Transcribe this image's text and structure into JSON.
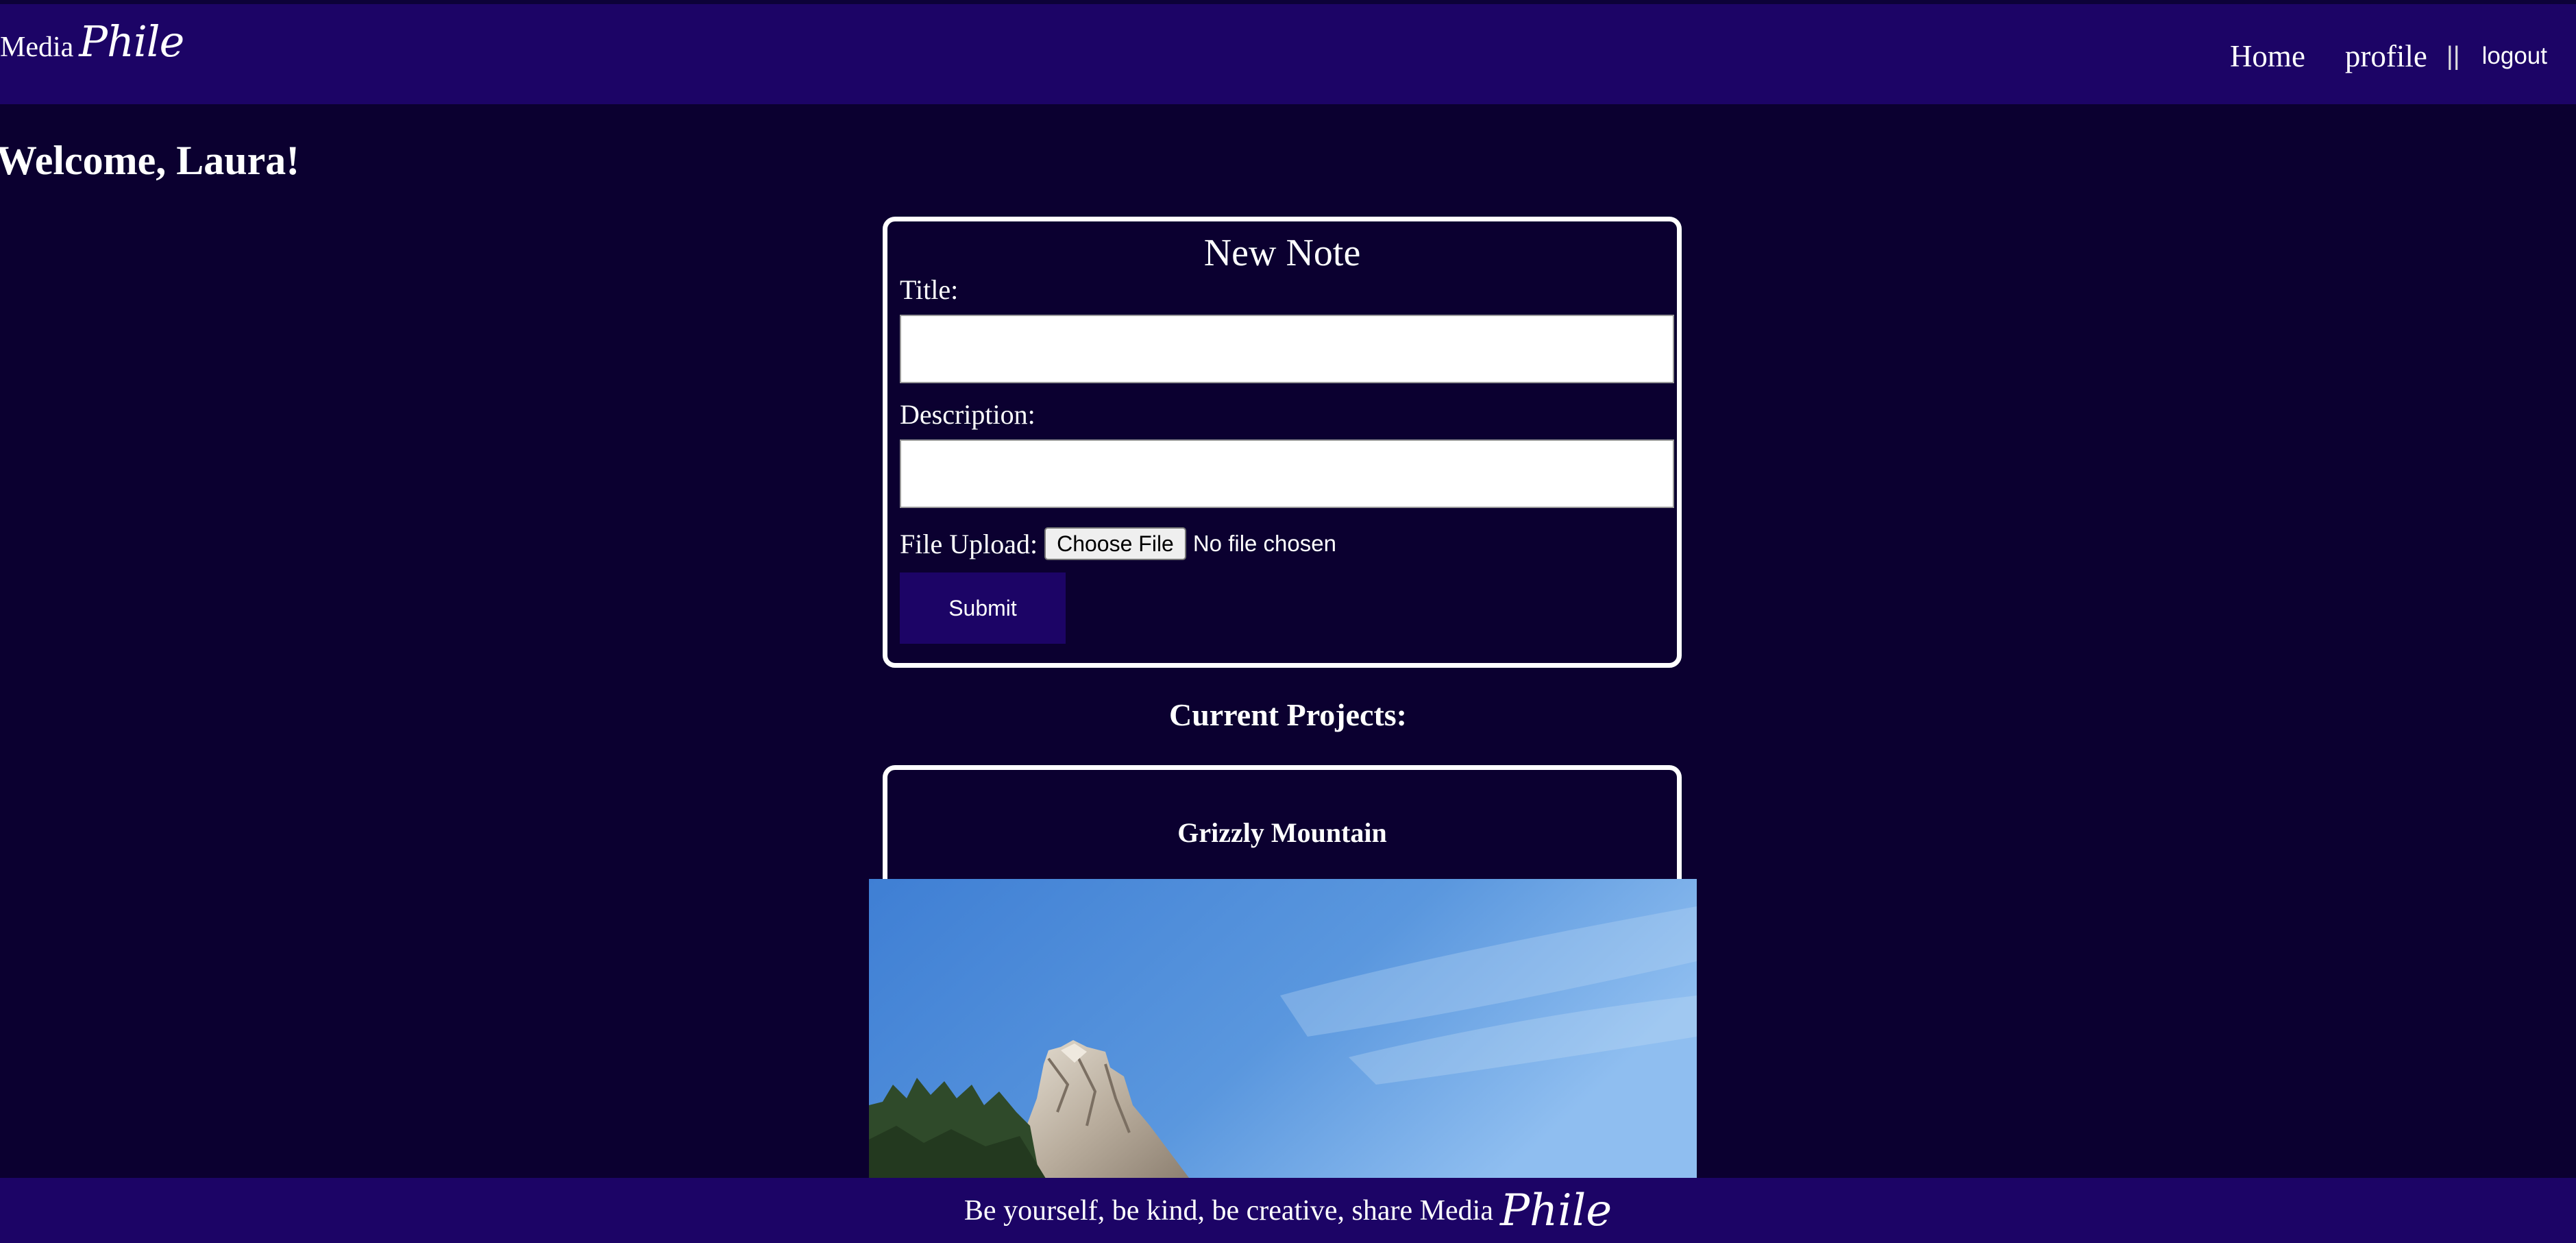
{
  "brand": {
    "media": "Media",
    "phile": "Phile"
  },
  "nav": {
    "home": "Home",
    "profile": "profile",
    "separator": "||",
    "logout": "logout"
  },
  "welcome": "Welcome, Laura!",
  "note_form": {
    "heading": "New Note",
    "title_label": "Title:",
    "title_value": "",
    "description_label": "Description:",
    "description_value": "",
    "file_label": "File Upload:",
    "file_button": "Choose File",
    "file_status": "No file chosen",
    "submit": "Submit"
  },
  "projects": {
    "heading": "Current Projects:",
    "items": [
      {
        "title": "Grizzly Mountain"
      }
    ]
  },
  "footer": {
    "text": "Be yourself, be kind, be creative, share Media",
    "phile": "Phile"
  },
  "colors": {
    "background": "#0b0030",
    "header": "#1c0466",
    "card_border": "#ffffff",
    "button": "#1c0466"
  }
}
